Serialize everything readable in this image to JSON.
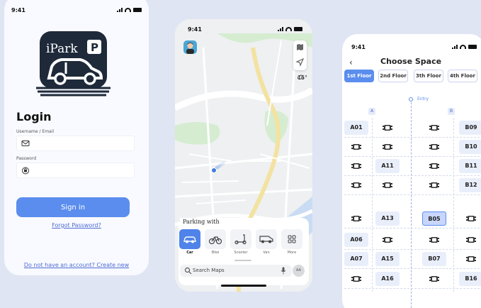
{
  "login_screen": {
    "status_time": "9:41",
    "logo_text": "iPark",
    "logo_badge": "P",
    "title": "Login",
    "username_label": "Username / Email",
    "password_label": "Password",
    "sign_in": "Sign in",
    "forgot_password": "Forgot Password?",
    "create_account": "Do not have an account? Create new",
    "accent": "#5b8dee"
  },
  "map_screen": {
    "status_time": "9:41",
    "weather_temp": "16°",
    "parking_with": "Parking with",
    "vehicles": [
      {
        "label": "Car",
        "icon": "car-icon",
        "active": true
      },
      {
        "label": "Bike",
        "icon": "bike-icon",
        "active": false
      },
      {
        "label": "Scooter",
        "icon": "scooter-icon",
        "active": false
      },
      {
        "label": "Van",
        "icon": "van-icon",
        "active": false
      },
      {
        "label": "More",
        "icon": "grid-icon",
        "active": false
      }
    ],
    "search_placeholder": "Search Maps",
    "avatar_initials": "AA"
  },
  "space_screen": {
    "status_time": "9:41",
    "title": "Choose Space",
    "floors": [
      {
        "label": "1st Floor",
        "active": true
      },
      {
        "label": "2nd Floor",
        "active": false
      },
      {
        "label": "3th Floor",
        "active": false
      },
      {
        "label": "4th Floor",
        "active": false
      }
    ],
    "entry": "Entry",
    "columns": [
      "A",
      "B"
    ],
    "rows": [
      {
        "a": [
          "A01",
          ""
        ],
        "b": [
          "",
          "B09"
        ]
      },
      {
        "a": [
          "",
          ""
        ],
        "b": [
          "",
          "B10"
        ]
      },
      {
        "a": [
          "",
          "A11"
        ],
        "b": [
          "",
          "B11"
        ]
      },
      {
        "a": [
          "",
          ""
        ],
        "b": [
          "",
          "B12"
        ]
      },
      {
        "a": [
          "",
          "A13"
        ],
        "b": [
          "B05",
          ""
        ]
      },
      {
        "a": [
          "A06",
          ""
        ],
        "b": [
          "",
          ""
        ]
      },
      {
        "a": [
          "A07",
          "A15"
        ],
        "b": [
          "B07",
          ""
        ]
      },
      {
        "a": [
          "",
          "A16"
        ],
        "b": [
          "",
          "B16"
        ]
      }
    ],
    "selected_slot": "B05"
  }
}
